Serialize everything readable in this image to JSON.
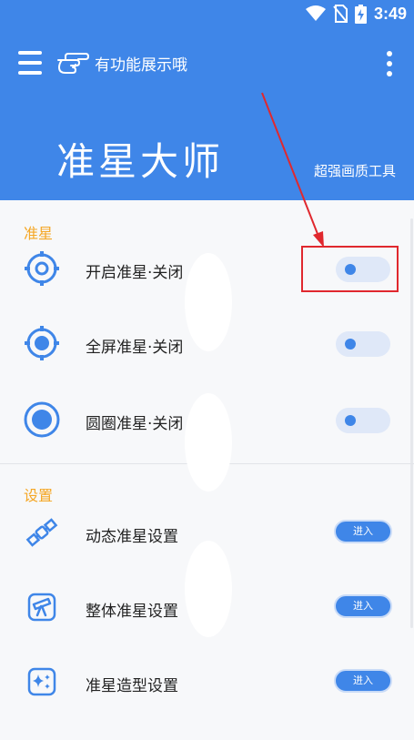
{
  "status": {
    "time": "3:49"
  },
  "header": {
    "hint_text": "有功能展示哦",
    "title": "准星大师",
    "subtitle": "超强画质工具"
  },
  "sections": {
    "crosshair": {
      "title": "准星",
      "items": [
        {
          "label": "开启准星·关闭",
          "icon": "crosshair-ring-icon",
          "control": "toggle",
          "on": false
        },
        {
          "label": "全屏准星·关闭",
          "icon": "crosshair-filled-icon",
          "control": "toggle",
          "on": false
        },
        {
          "label": "圆圈准星·关闭",
          "icon": "circle-dot-icon",
          "control": "toggle",
          "on": false
        }
      ]
    },
    "settings": {
      "title": "设置",
      "items": [
        {
          "label": "动态准星设置",
          "icon": "satellite-icon",
          "button": "进入"
        },
        {
          "label": "整体准星设置",
          "icon": "telescope-icon",
          "button": "进入"
        },
        {
          "label": "准星造型设置",
          "icon": "sparkle-icon",
          "button": "进入"
        }
      ]
    }
  },
  "colors": {
    "primary": "#3f86e8",
    "accent": "#f5a623",
    "annotation": "#e0282e"
  }
}
